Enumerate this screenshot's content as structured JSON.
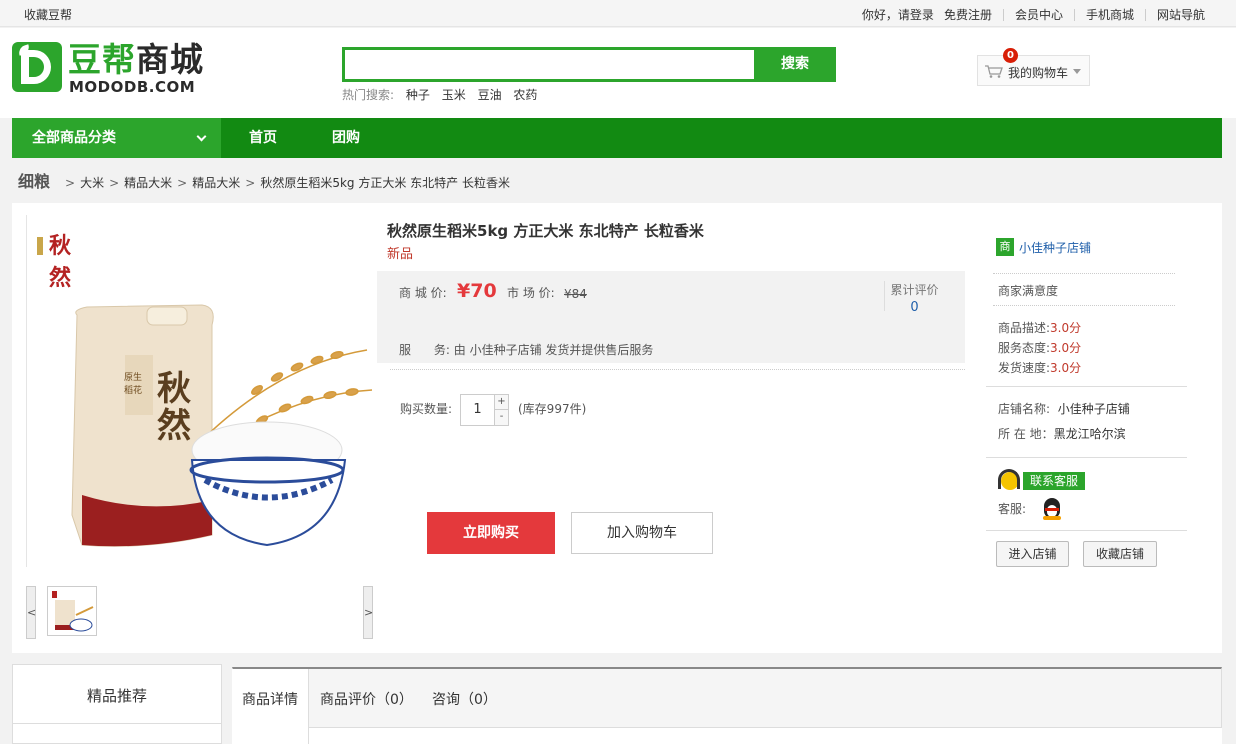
{
  "topbar": {
    "favorite": "收藏豆帮",
    "greeting": "你好，请登录",
    "register": "免费注册",
    "member_center": "会员中心",
    "mobile_mall": "手机商城",
    "site_nav": "网站导航"
  },
  "logo": {
    "cn_part1": "豆帮",
    "cn_part2": "商城",
    "en": "MODODB.COM"
  },
  "search": {
    "value": "",
    "placeholder": "",
    "button": "搜索",
    "hot_label": "热门搜索:",
    "hot_keywords": [
      "种子",
      "玉米",
      "豆油",
      "农药"
    ]
  },
  "cart": {
    "count": "0",
    "label": "我的购物车",
    "icon": "cart-icon"
  },
  "nav": {
    "all_categories": "全部商品分类",
    "items": [
      "首页",
      "团购"
    ]
  },
  "breadcrumb": {
    "main": "细粮",
    "levels": [
      "大米",
      "精品大米",
      "精品大米",
      "秋然原生稻米5kg 方正大米 东北特产 长粒香米"
    ],
    "separator": ">"
  },
  "product": {
    "title": "秋然原生稻米5kg 方正大米 东北特产 长粒香米",
    "tag": "新品",
    "price_label": "商 城 价:",
    "price": "¥70",
    "market_price_label": "市 场 价:",
    "market_price": "¥84",
    "review_label": "累计评价",
    "review_count": "0",
    "service_label": "服      务:",
    "service_text": "由 小佳种子店铺 发货并提供售后服务",
    "quantity_label": "购买数量:",
    "quantity": "1",
    "plus": "+",
    "minus": "-",
    "stock": "(库存997件)",
    "buy_now": "立即购买",
    "add_to_cart": "加入购物车",
    "brand_vertical": "秋然",
    "gallery_prev": "<",
    "gallery_next": ">"
  },
  "shop": {
    "badge": "商",
    "name": "小佳种子店铺",
    "satisfaction": "商家满意度",
    "ratings": [
      {
        "label": "商品描述:",
        "value": "3.0分"
      },
      {
        "label": "服务态度:",
        "value": "3.0分"
      },
      {
        "label": "发货速度:",
        "value": "3.0分"
      }
    ],
    "store_name_label": "店铺名称:",
    "store_name": "小佳种子店铺",
    "location_label": "所 在 地：",
    "location": "黑龙江哈尔滨",
    "contact": "联系客服",
    "service_label": "客服:",
    "enter_store": "进入店铺",
    "favorite_store": "收藏店铺"
  },
  "bottom": {
    "recommend": "精品推荐",
    "tabs": [
      "商品详情",
      "商品评价（0）",
      "咨询（0）"
    ]
  },
  "colors": {
    "brand_green": "#2ca52c",
    "nav_green": "#128a12",
    "price_red": "#e4393c",
    "link_blue": "#1f5faa"
  }
}
